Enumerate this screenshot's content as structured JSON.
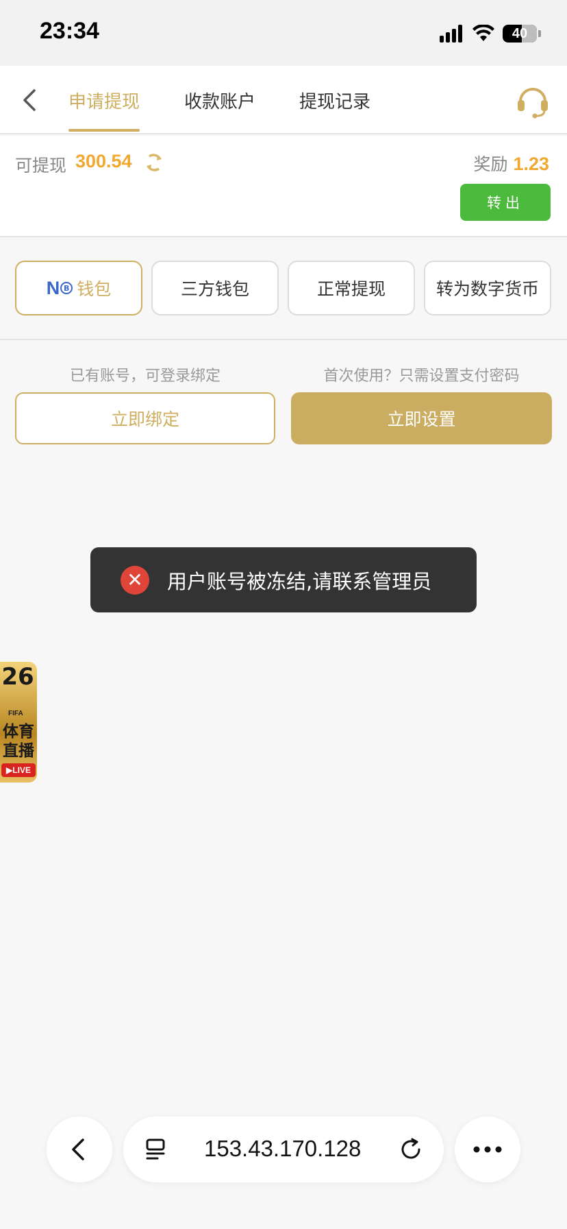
{
  "status_bar": {
    "time": "23:34",
    "battery": "40"
  },
  "nav": {
    "tabs": [
      {
        "label": "申请提现"
      },
      {
        "label": "收款账户"
      },
      {
        "label": "提现记录"
      }
    ]
  },
  "balance": {
    "label": "可提现",
    "value": "300.54",
    "reward_label": "奖励",
    "reward_value": "1.23",
    "transfer_label": "转出"
  },
  "wallet_options": [
    {
      "logo_letter": "N",
      "logo_badge": "B",
      "label": "钱包"
    },
    {
      "label": "三方钱包"
    },
    {
      "label": "正常提现"
    },
    {
      "label": "转为数字货币"
    }
  ],
  "bind": {
    "left_hint": "已有账号，可登录绑定",
    "left_button": "立即绑定",
    "right_hint": "首次使用？只需设置支付密码",
    "right_button": "立即设置"
  },
  "toast": {
    "message": "用户账号被冻结,请联系管理员"
  },
  "live_badge": {
    "number": "26",
    "org": "FIFA",
    "text": "体育直播",
    "tag": "LIVE"
  },
  "browser": {
    "url": "153.43.170.128"
  },
  "colors": {
    "gold": "#cfae60",
    "green": "#4cbb3d",
    "orange": "#f0a830",
    "toast_bg": "#333333",
    "error_red": "#e0453a"
  }
}
